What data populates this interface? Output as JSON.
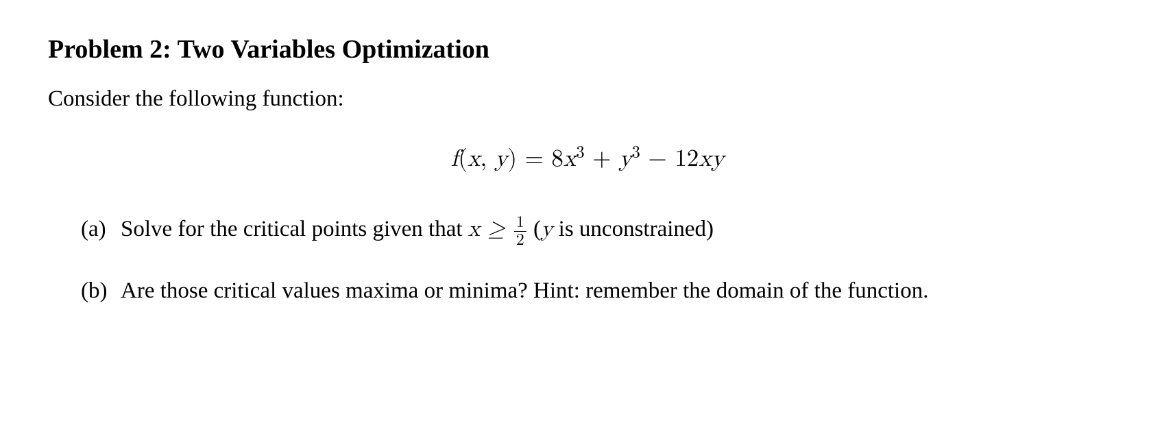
{
  "title": "Problem 2: Two Variables Optimization",
  "intro": "Consider the following function:",
  "equation": {
    "lhs_f": "f",
    "lhs_open": "(",
    "lhs_x": "x",
    "lhs_comma": ", ",
    "lhs_y": "y",
    "lhs_close": ") = ",
    "coef8": "8",
    "x": "x",
    "pow3a": "3",
    "plus": " + ",
    "y": "y",
    "pow3b": "3",
    "minus": " − ",
    "coef12": "12",
    "x2": "x",
    "y2": "y"
  },
  "parts": {
    "a": {
      "label": "(a)",
      "pre": "Solve for the critical points given that ",
      "math_x": "x",
      "math_geq": " ≥ ",
      "frac_num": "1",
      "frac_den": "2",
      "post_open": " (",
      "math_y": "y",
      "post": " is unconstrained)"
    },
    "b": {
      "label": "(b)",
      "text": "Are those critical values maxima or minima?  Hint: remember the domain of the function."
    }
  }
}
